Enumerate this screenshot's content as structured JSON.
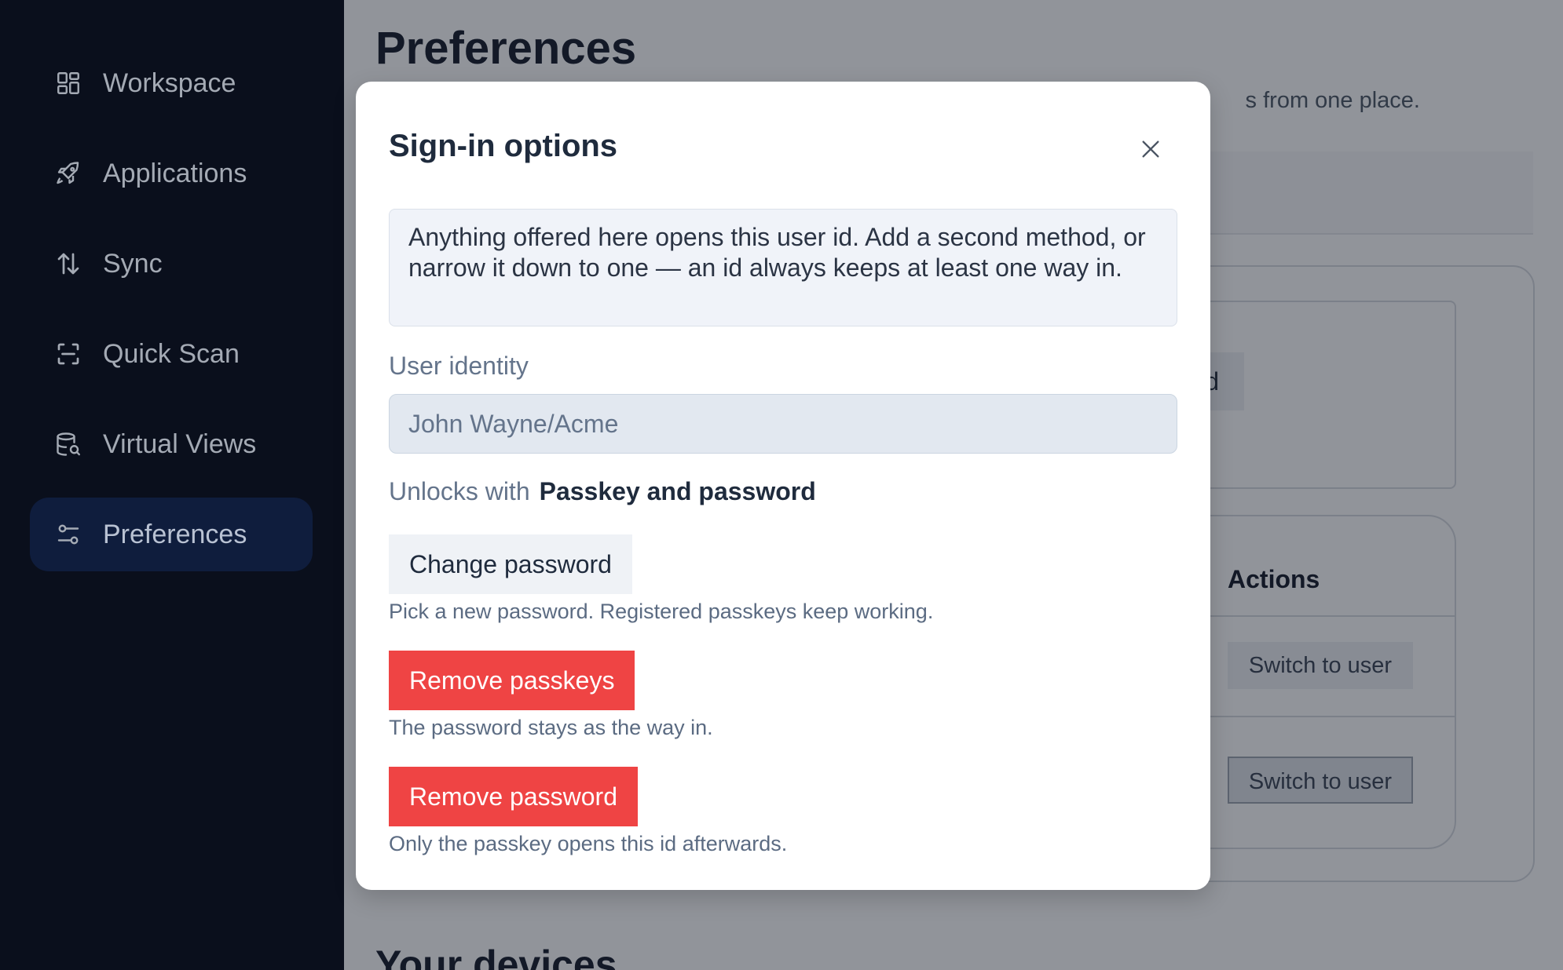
{
  "sidebar": {
    "items": [
      {
        "label": "Workspace",
        "icon": "grid-icon",
        "active": false
      },
      {
        "label": "Applications",
        "icon": "rocket-icon",
        "active": false
      },
      {
        "label": "Sync",
        "icon": "arrows-up-down-icon",
        "active": false
      },
      {
        "label": "Quick Scan",
        "icon": "scan-icon",
        "active": false
      },
      {
        "label": "Virtual Views",
        "icon": "database-search-icon",
        "active": false
      },
      {
        "label": "Preferences",
        "icon": "sliders-icon",
        "active": true
      }
    ]
  },
  "page": {
    "title": "Preferences",
    "subtitle_fragment": "s from one place.",
    "chip_fragment": "user id",
    "actions_header": "Actions",
    "switch_label": "Switch to user",
    "section_title": "Your devices"
  },
  "modal": {
    "title": "Sign-in options",
    "close_icon": "close-icon",
    "info": "Anything offered here opens this user id. Add a second method, or narrow it down to one — an id always keeps at least one way in.",
    "identity_label": "User identity",
    "identity_value": "John Wayne/Acme",
    "unlocks_label": "Unlocks with",
    "unlocks_value": "Passkey and password",
    "change_password": {
      "label": "Change password",
      "hint": "Pick a new password. Registered passkeys keep working."
    },
    "remove_passkeys": {
      "label": "Remove passkeys",
      "hint": "The password stays as the way in."
    },
    "remove_password": {
      "label": "Remove password",
      "hint": "Only the passkey opens this id afterwards."
    }
  },
  "colors": {
    "sidebar_bg": "#0a0f1c",
    "active_item_bg": "#0f1d3d",
    "danger": "#ef4444",
    "overlay": "rgba(21,27,40,0.47)"
  }
}
